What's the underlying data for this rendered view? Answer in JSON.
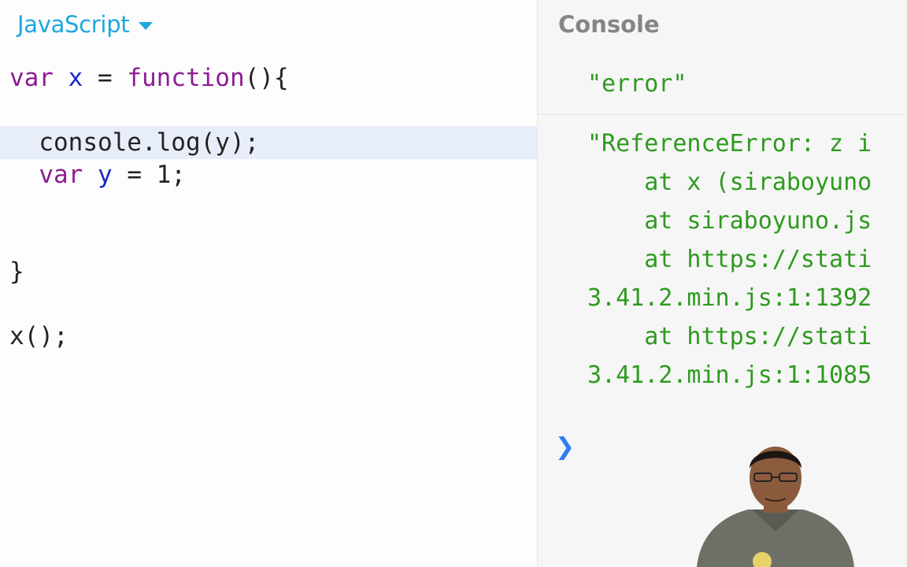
{
  "editor": {
    "language": "JavaScript",
    "lines": [
      {
        "tokens": [
          {
            "t": "var ",
            "c": "kw"
          },
          {
            "t": "x",
            "c": "var"
          },
          {
            "t": " = ",
            "c": "plain"
          },
          {
            "t": "function",
            "c": "kw"
          },
          {
            "t": "(){",
            "c": "plain"
          }
        ]
      },
      {
        "tokens": []
      },
      {
        "tokens": [
          {
            "t": "  console.log(y);",
            "c": "plain"
          }
        ],
        "highlight": true
      },
      {
        "tokens": [
          {
            "t": "  ",
            "c": "plain"
          },
          {
            "t": "var ",
            "c": "kw"
          },
          {
            "t": "y",
            "c": "var"
          },
          {
            "t": " = 1;",
            "c": "plain"
          }
        ]
      },
      {
        "tokens": []
      },
      {
        "tokens": []
      },
      {
        "tokens": [
          {
            "t": "}",
            "c": "plain"
          }
        ]
      },
      {
        "tokens": []
      },
      {
        "tokens": [
          {
            "t": "x();",
            "c": "plain"
          }
        ]
      }
    ]
  },
  "console": {
    "title": "Console",
    "entries": [
      "\"error\"",
      "\"ReferenceError: z i",
      "    at x (siraboyuno",
      "    at siraboyuno.js",
      "    at https://stati",
      "3.41.2.min.js:1:1392",
      "    at https://stati",
      "3.41.2.min.js:1:1085"
    ],
    "prompt_icon": "chevron-right-icon",
    "colors": {
      "output": "#2e9a1f",
      "prompt": "#2f7cf6",
      "title": "#858585"
    }
  },
  "colors": {
    "keyword": "#8c1d93",
    "identifier": "#1a27c9",
    "accent": "#1ea7df",
    "highlight": "#e8eef9"
  }
}
